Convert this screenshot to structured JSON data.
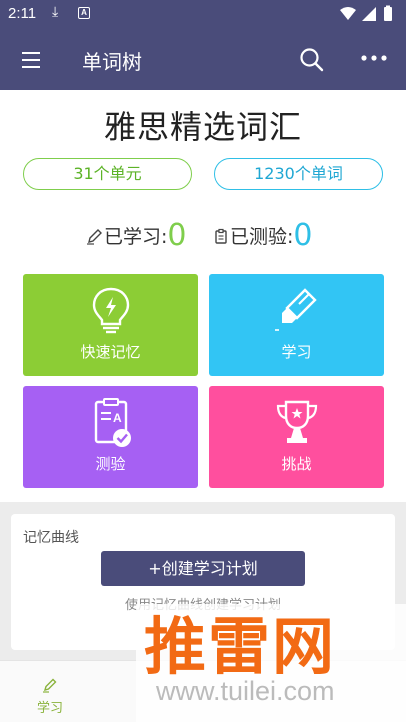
{
  "status_bar": {
    "time": "2:11",
    "notif_letter": "A"
  },
  "app_bar": {
    "title": "单词树"
  },
  "book": {
    "title": "雅思精选词汇"
  },
  "summary": {
    "units": "31个单元",
    "words": "1230个单词"
  },
  "stats": {
    "learned_label": "已学习:",
    "learned_value": "0",
    "tested_label": "已测验:",
    "tested_value": "0"
  },
  "tiles": {
    "quick_memory": "快速记忆",
    "study": "学习",
    "test": "测验",
    "challenge": "挑战"
  },
  "curve": {
    "title": "记忆曲线",
    "create_plan": "+创建学习计划",
    "hint": "使用记忆曲线创建学习计划"
  },
  "bottom_nav": {
    "study": "学习"
  },
  "watermark": {
    "brand": "推雷网",
    "url": "www.tuilei.com"
  },
  "colors": {
    "primary": "#4a4c7a",
    "green": "#8ccd35",
    "cyan": "#32c5f4",
    "purple": "#a660f3",
    "pink": "#ff4f9e"
  },
  "icons": {
    "menu": "hamburger-icon",
    "search": "search-icon",
    "more": "more-dots-icon",
    "quick_memory": "lightbulb-icon",
    "study": "highlighter-icon",
    "test": "checklist-icon",
    "challenge": "trophy-icon",
    "learned": "pencil-icon",
    "tested": "clipboard-icon"
  }
}
